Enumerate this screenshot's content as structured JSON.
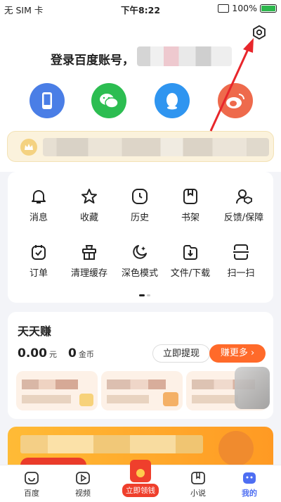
{
  "status_bar": {
    "carrier": "无 SIM 卡",
    "time": "下午8:22",
    "battery": "100%"
  },
  "account": {
    "login_prompt": "登录百度账号，"
  },
  "social_logins": [
    {
      "name": "phone",
      "icon": "phone-icon",
      "color": "#4a7ee6"
    },
    {
      "name": "wechat",
      "icon": "wechat-icon",
      "color": "#2cbd51"
    },
    {
      "name": "qq",
      "icon": "qq-icon",
      "color": "#2f95f0"
    },
    {
      "name": "weibo",
      "icon": "weibo-icon",
      "color": "#ee6a4c"
    }
  ],
  "menu": {
    "row1": [
      {
        "label": "消息",
        "icon": "bell-icon"
      },
      {
        "label": "收藏",
        "icon": "star-icon"
      },
      {
        "label": "历史",
        "icon": "clock-icon"
      },
      {
        "label": "书架",
        "icon": "bookshelf-icon"
      },
      {
        "label": "反馈/保障",
        "icon": "feedback-icon"
      }
    ],
    "row2": [
      {
        "label": "订单",
        "icon": "order-icon"
      },
      {
        "label": "清理缓存",
        "icon": "clean-cache-icon"
      },
      {
        "label": "深色模式",
        "icon": "dark-mode-icon"
      },
      {
        "label": "文件/下载",
        "icon": "download-icon"
      },
      {
        "label": "扫一扫",
        "icon": "scan-icon"
      }
    ]
  },
  "earn": {
    "title": "天天赚",
    "cash": "0.00",
    "cash_unit": "元",
    "coins": "0",
    "coin_unit": "金币",
    "withdraw_label": "立即提现",
    "earn_more_label": "赚更多 ›"
  },
  "tabbar": {
    "items": [
      {
        "label": "百度",
        "icon": "baidu-home-icon"
      },
      {
        "label": "视频",
        "icon": "video-icon"
      },
      {
        "label": "立即领钱",
        "icon": "red-envelope-icon"
      },
      {
        "label": "小说",
        "icon": "novel-icon"
      },
      {
        "label": "我的",
        "icon": "profile-icon"
      }
    ]
  },
  "colors": {
    "accent": "#ff6a2a",
    "active_tab": "#4e6ef2",
    "vip_bg": "#fbf2dc",
    "annotation_arrow": "#e8262b"
  }
}
